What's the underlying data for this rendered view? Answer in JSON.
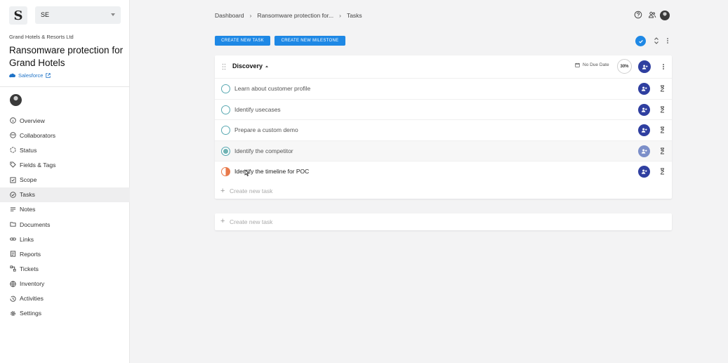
{
  "sidebar": {
    "logo_letter": "S",
    "workspace": "SE",
    "company": "Grand Hotels & Resorts Ltd",
    "project_title": "Ransomware protection for Grand Hotels",
    "crm_link": "Salesforce",
    "items": [
      {
        "label": "Overview",
        "icon": "info-icon"
      },
      {
        "label": "Collaborators",
        "icon": "collaborators-icon"
      },
      {
        "label": "Status",
        "icon": "status-icon"
      },
      {
        "label": "Fields & Tags",
        "icon": "tag-icon"
      },
      {
        "label": "Scope",
        "icon": "checkbox-icon"
      },
      {
        "label": "Tasks",
        "icon": "check-circle-icon",
        "active": true
      },
      {
        "label": "Notes",
        "icon": "notes-icon"
      },
      {
        "label": "Documents",
        "icon": "folder-icon"
      },
      {
        "label": "Links",
        "icon": "link-icon"
      },
      {
        "label": "Reports",
        "icon": "report-icon"
      },
      {
        "label": "Tickets",
        "icon": "tickets-icon"
      },
      {
        "label": "Inventory",
        "icon": "globe-icon"
      },
      {
        "label": "Activities",
        "icon": "history-icon"
      },
      {
        "label": "Settings",
        "icon": "gear-icon"
      }
    ]
  },
  "header": {
    "breadcrumb": [
      "Dashboard",
      "Ransomware protection for...",
      "Tasks"
    ],
    "icons": [
      "help-icon",
      "people-icon",
      "gear-icon"
    ]
  },
  "toolbar": {
    "create_task": "CREATE NEW TASK",
    "create_milestone": "CREATE NEW MILESTONE"
  },
  "milestone": {
    "title": "Discovery",
    "due": "No Due Date",
    "progress": "30%",
    "tasks": [
      {
        "label": "Learn about customer profile",
        "status": "open"
      },
      {
        "label": "Identify usecases",
        "status": "open"
      },
      {
        "label": "Prepare a custom demo",
        "status": "open"
      },
      {
        "label": "Identify the competitor",
        "status": "done"
      },
      {
        "label": "Identify the timeline for POC",
        "status": "in-progress"
      }
    ],
    "create_task": "Create new task"
  },
  "bottom_create": "Create new task",
  "colors": {
    "primary": "#1e88e5",
    "assign": "#2f3fa0",
    "status_open": "#5aa9b2",
    "status_progress": "#e8794a",
    "crm": "#1f73c7"
  }
}
